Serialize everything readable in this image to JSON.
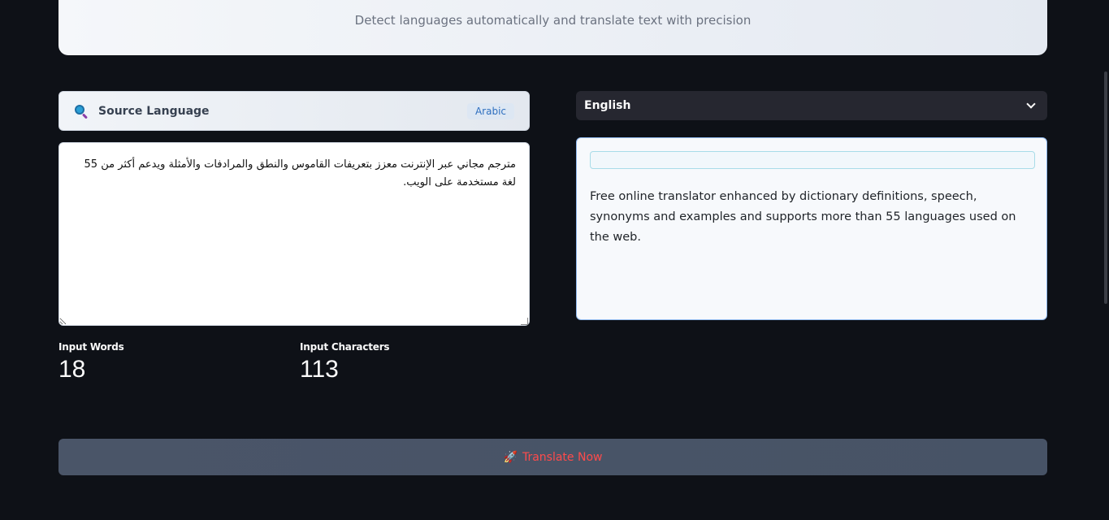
{
  "header": {
    "subtitle": "Detect languages automatically and translate text with precision"
  },
  "source": {
    "label": "Source Language",
    "detected_language": "Arabic",
    "icon": "search-icon",
    "input_text": "مترجم مجاني عبر الإنترنت معزز بتعريفات القاموس والنطق والمرادفات والأمثلة ويدعم أكثر من 55 لغة مستخدمة على الويب."
  },
  "metrics": {
    "words_label": "Input Words",
    "words_value": "18",
    "chars_label": "Input Characters",
    "chars_value": "113"
  },
  "target": {
    "selected_language": "English",
    "output_text": "Free online translator enhanced by dictionary definitions, speech, synonyms and examples and supports more than 55 languages used on the web."
  },
  "actions": {
    "translate_label": "Translate Now",
    "translate_icon": "🚀"
  },
  "colors": {
    "background": "#0e1117",
    "accent_red": "#ff4b4b",
    "badge_blue": "#2e6fbf"
  }
}
